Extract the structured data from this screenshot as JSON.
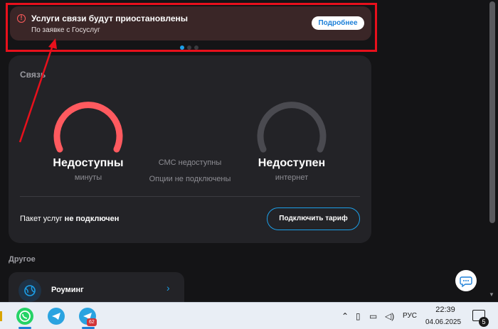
{
  "alert": {
    "icon": "exclamation-circle-icon",
    "title": "Услуги связи будут приостановлены",
    "subtitle": "По заявке с Госуслуг",
    "button_label": "Подробнее",
    "icon_glyph": "!"
  },
  "carousel": {
    "total": 3,
    "active": 1
  },
  "connection": {
    "title": "Связь",
    "minutes": {
      "value": "Недоступны",
      "label": "минуты"
    },
    "sms": {
      "status": "СМС недоступны",
      "options": "Опции не подключены"
    },
    "internet": {
      "value": "Недоступен",
      "label": "интернет"
    },
    "package_prefix": "Пакет услуг ",
    "package_status": "не подключен",
    "connect_button": "Подключить тариф"
  },
  "other": {
    "title": "Другое",
    "roaming": {
      "label": "Роуминг",
      "icon": "globe-icon",
      "chevron": "›"
    }
  },
  "taskbar": {
    "telegram_badge": "62",
    "language": "РУС",
    "time": "22:39",
    "date": "04.06.2025",
    "notifications": "5"
  },
  "colors": {
    "alert_accent": "#ff5b5b",
    "highlight_red": "#e8101c",
    "brand_blue": "#1c9fe8",
    "gauge_red": "#ff5a5f",
    "gauge_gray": "#4a4a50"
  }
}
